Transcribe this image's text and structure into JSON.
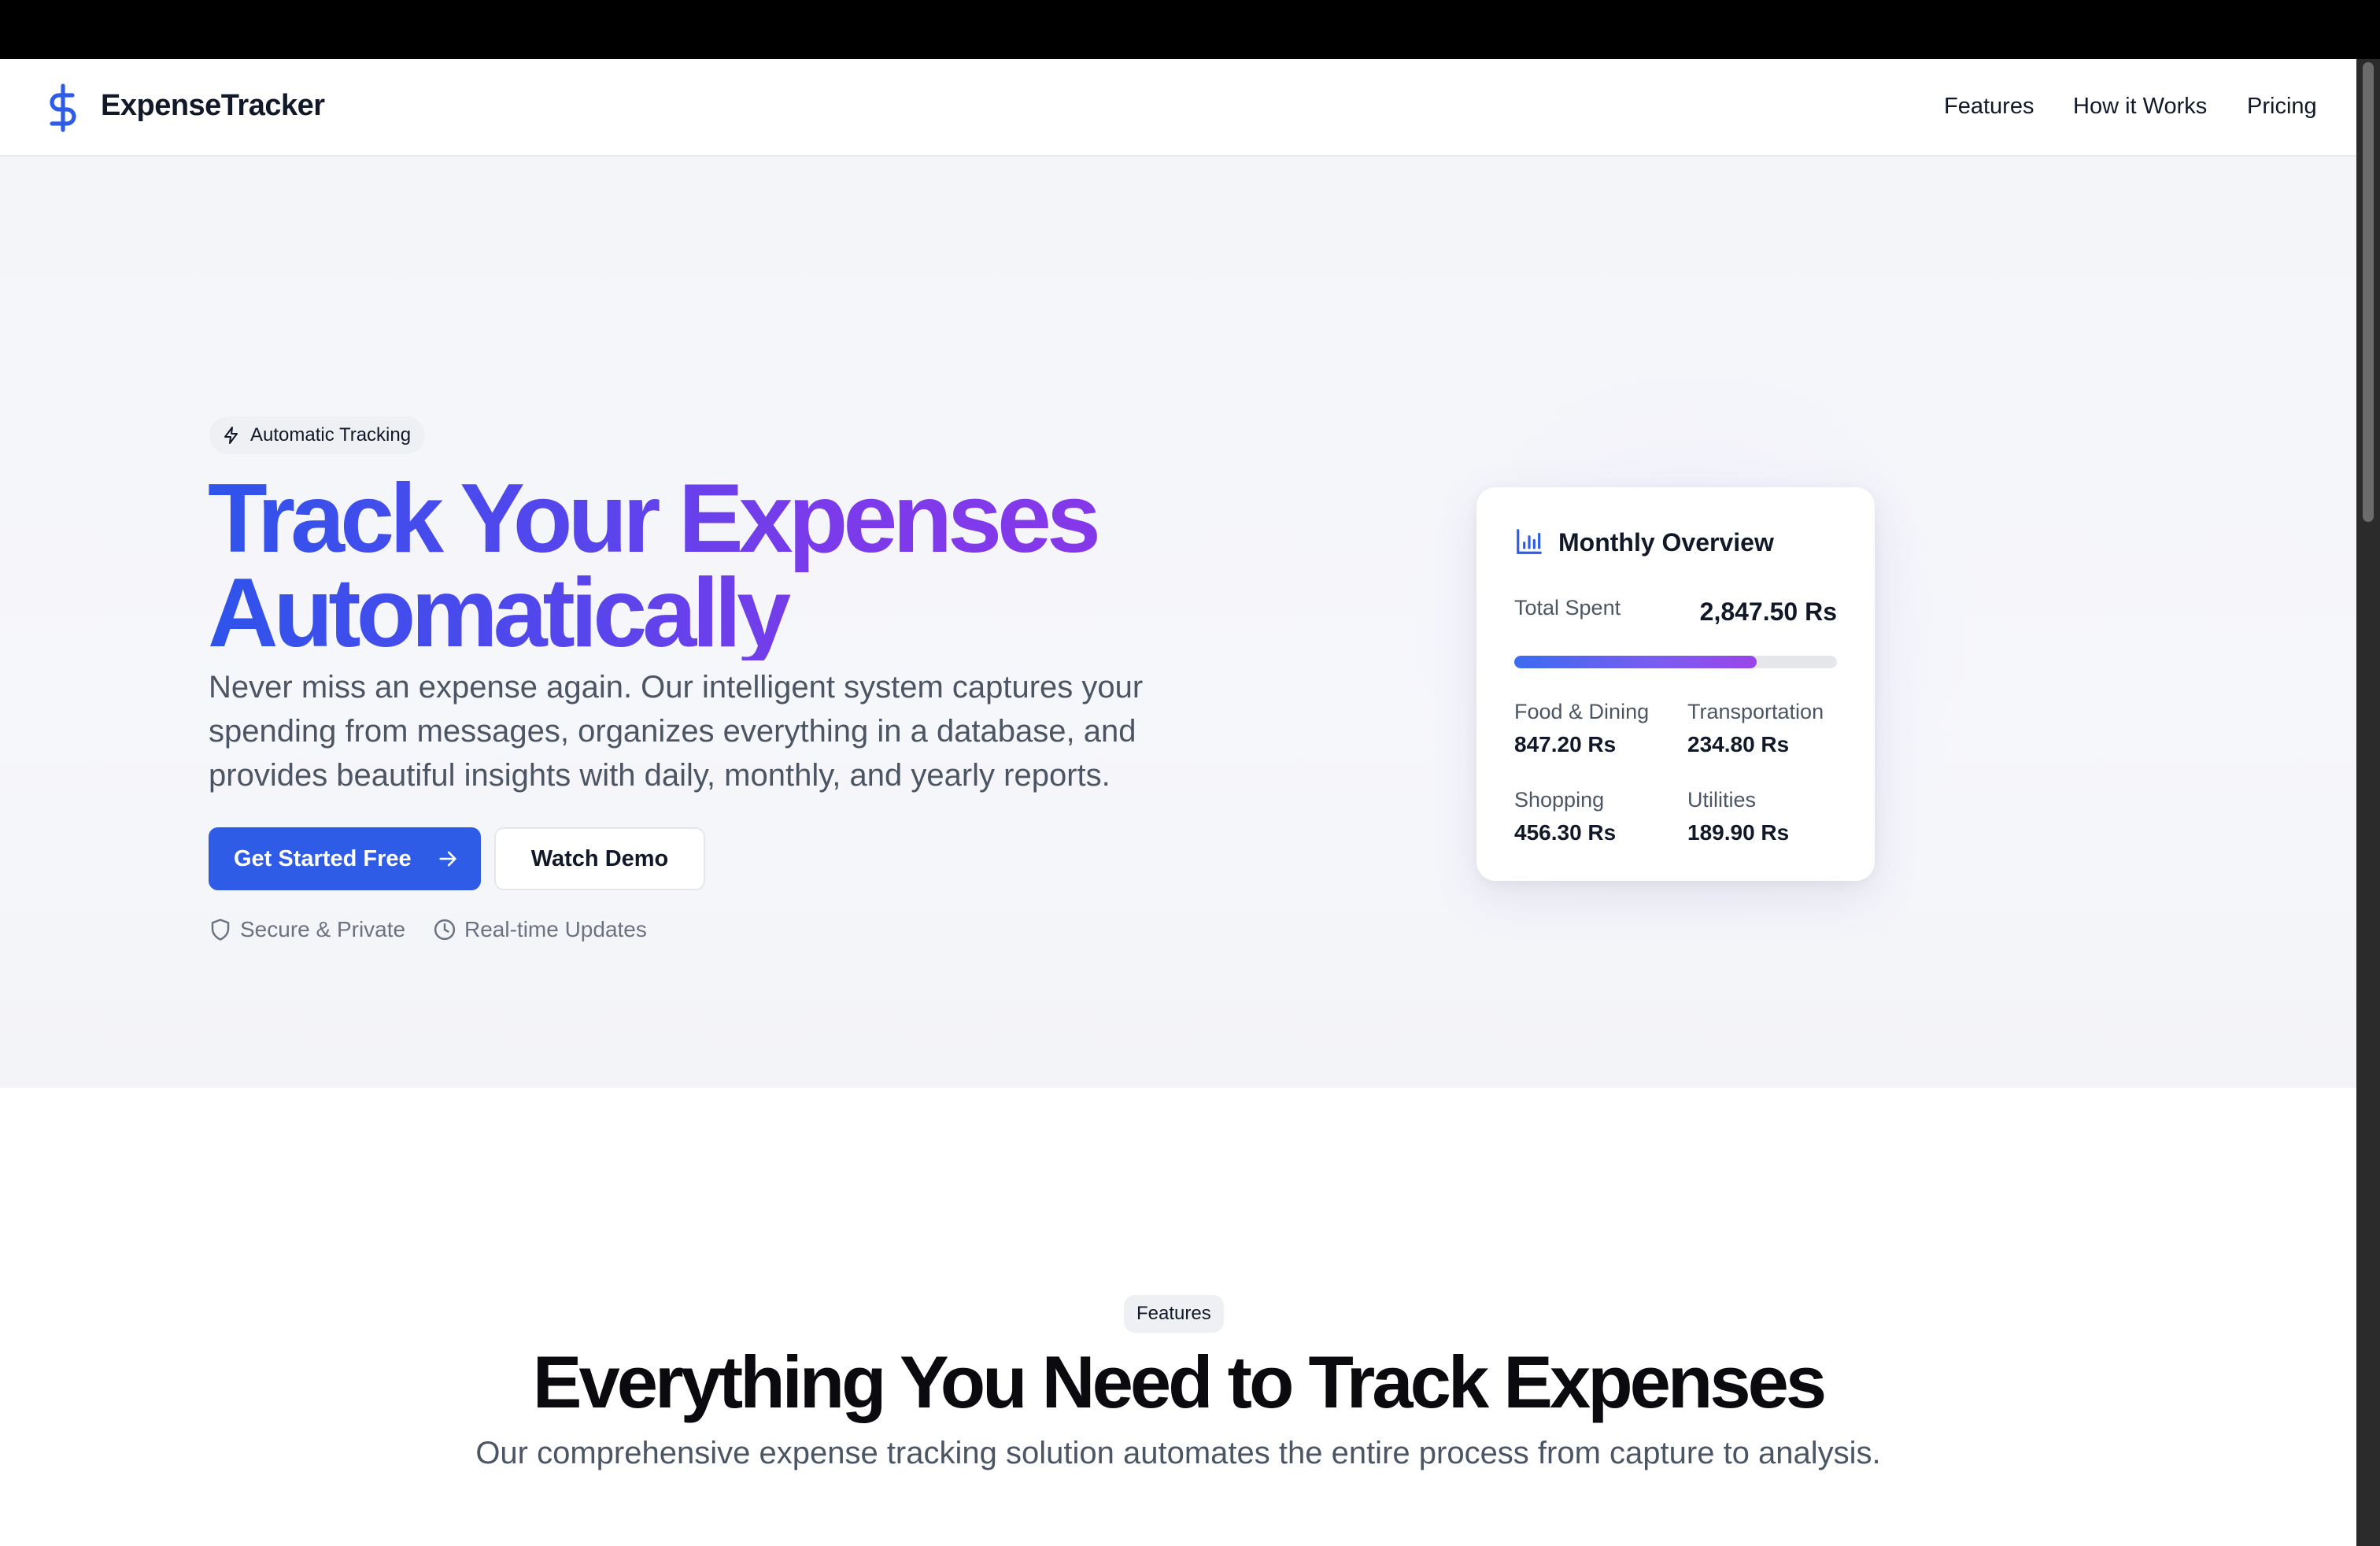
{
  "app": {
    "name": "ExpenseTracker"
  },
  "nav": {
    "links": [
      "Features",
      "How it Works",
      "Pricing"
    ]
  },
  "hero": {
    "badge": "Automatic Tracking",
    "title_line1": "Track Your Expenses",
    "title_line2": "Automatically",
    "description": "Never miss an expense again. Our intelligent system captures your spending from messages, organizes everything in a database, and provides beautiful insights with daily, monthly, and yearly reports.",
    "cta_primary": "Get Started Free",
    "cta_secondary": "Watch Demo",
    "trust": [
      "Secure & Private",
      "Real-time Updates"
    ]
  },
  "overview": {
    "title": "Monthly Overview",
    "total_label": "Total Spent",
    "total_value": "2,847.50 Rs",
    "progress_fraction": 0.75,
    "categories": [
      {
        "label": "Food & Dining",
        "value": "847.20 Rs"
      },
      {
        "label": "Transportation",
        "value": "234.80 Rs"
      },
      {
        "label": "Shopping",
        "value": "456.30 Rs"
      },
      {
        "label": "Utilities",
        "value": "189.90 Rs"
      }
    ]
  },
  "features": {
    "badge": "Features",
    "title": "Everything You Need to Track Expenses",
    "subtitle": "Our comprehensive expense tracking solution automates the entire process from capture to analysis."
  },
  "colors": {
    "accent": "#2e5ce6",
    "gradient_start": "#2f54eb",
    "gradient_end": "#8a37e8"
  }
}
